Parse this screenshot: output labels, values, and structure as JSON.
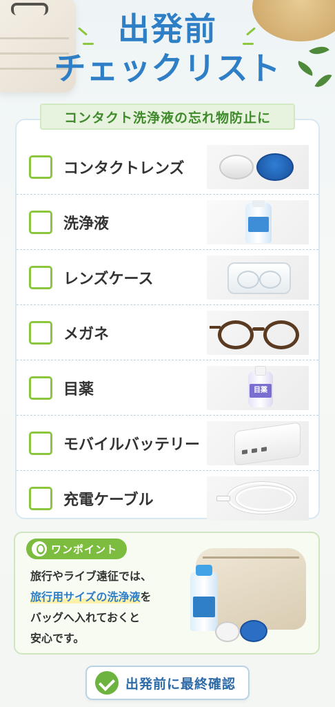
{
  "header": {
    "title_line1": "出発前",
    "title_line2": "チェックリスト",
    "subtitle": "コンタクト洗浄液の忘れ物防止に"
  },
  "checklist": {
    "items": [
      {
        "label": "コンタクトレンズ",
        "image": "contact-lens-case"
      },
      {
        "label": "洗浄液",
        "image": "cleaning-solution-bottle"
      },
      {
        "label": "レンズケース",
        "image": "clear-lens-case"
      },
      {
        "label": "メガネ",
        "image": "glasses"
      },
      {
        "label": "目薬",
        "image": "eye-drops",
        "image_text": "目薬"
      },
      {
        "label": "モバイルバッテリー",
        "image": "mobile-battery"
      },
      {
        "label": "充電ケーブル",
        "image": "charging-cable"
      }
    ]
  },
  "onepoint": {
    "badge": "ワンポイント",
    "text_line1": "旅行やライブ遠征では、",
    "text_highlight": "旅行用サイズの洗浄液",
    "text_line2_suffix": "を",
    "text_line3": "バッグへ入れておくと",
    "text_line4": "安心です。"
  },
  "final_button": {
    "label": "出発前に最終確認"
  },
  "colors": {
    "title_blue": "#2f7fc6",
    "accent_green": "#8cc63f",
    "subtitle_green": "#3f8a2b"
  }
}
